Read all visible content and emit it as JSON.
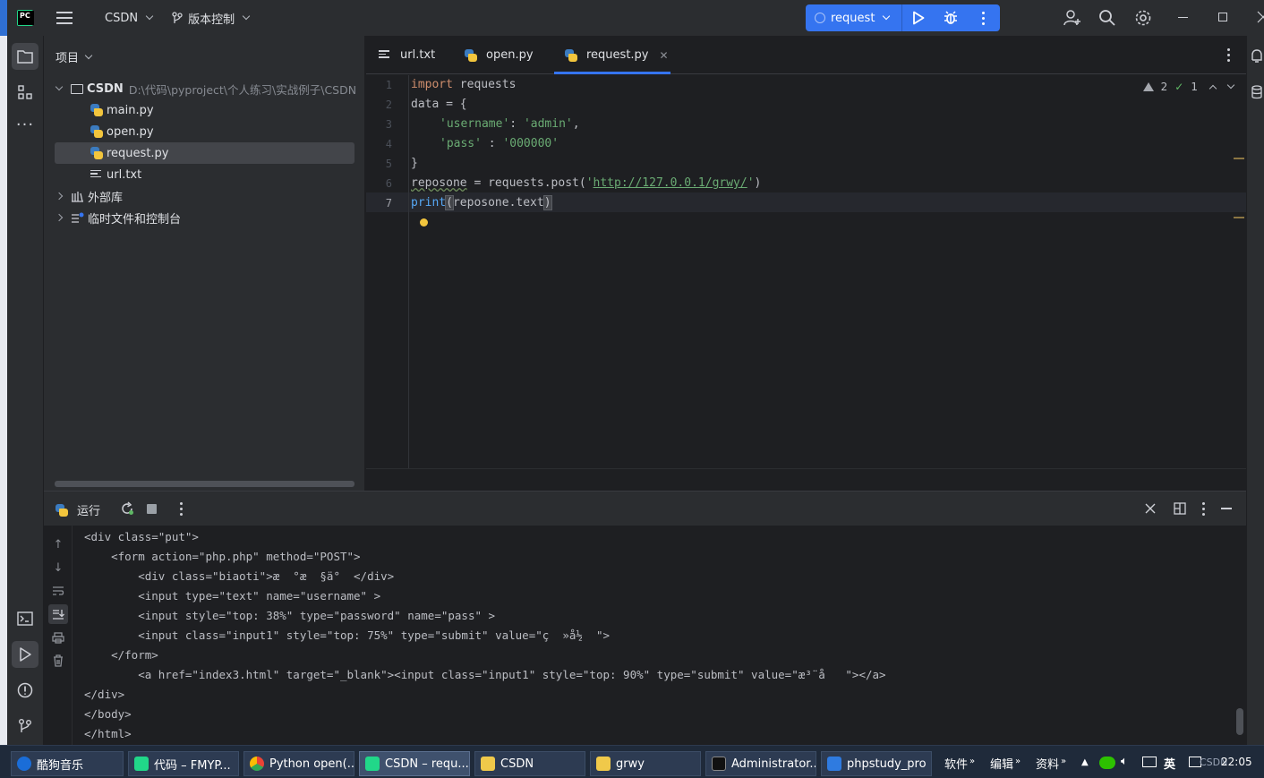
{
  "titlebar": {
    "project_name": "CSDN",
    "vcs_label": "版本控制",
    "run_config": "request"
  },
  "project_panel": {
    "header": "项目",
    "tree": [
      {
        "label": "CSDN",
        "path": "D:\\代码\\pyproject\\个人练习\\实战例子\\CSDN",
        "type": "folder",
        "expanded": true
      },
      {
        "label": "main.py",
        "type": "python"
      },
      {
        "label": "open.py",
        "type": "python"
      },
      {
        "label": "request.py",
        "type": "python",
        "selected": true
      },
      {
        "label": "url.txt",
        "type": "text"
      },
      {
        "label": "外部库",
        "type": "library",
        "expanded": false
      },
      {
        "label": "临时文件和控制台",
        "type": "scratches",
        "expanded": false
      }
    ]
  },
  "editor": {
    "tabs": [
      {
        "label": "url.txt",
        "icon": "text-file-icon"
      },
      {
        "label": "open.py",
        "icon": "python-file-icon"
      },
      {
        "label": "request.py",
        "icon": "python-file-icon",
        "active": true
      }
    ],
    "line_numbers": [
      "1",
      "2",
      "3",
      "4",
      "5",
      "6",
      "7"
    ],
    "current_line": 7,
    "code": {
      "l1_kw": "import",
      "l1_rest": " requests",
      "l2": "data = {",
      "l3_key": "'username'",
      "l3_mid": ": ",
      "l3_val": "'admin'",
      "l3_end": ",",
      "l4_key": "'pass'",
      "l4_mid": " : ",
      "l4_val": "'000000'",
      "l5": "}",
      "l6_var": "reposone",
      "l6_mid": " = requests.post(",
      "l6_q1": "'",
      "l6_url": "http://127.0.0.1/grwy/",
      "l6_q2": "'",
      "l6_end": ")",
      "l7_fn": "print",
      "l7_open": "(",
      "l7_arg": "reposone.text",
      "l7_close": ")"
    },
    "inspections": {
      "warnings": "2",
      "ok": "1"
    }
  },
  "run_panel": {
    "title": "运行",
    "output": [
      "<div class=\"put\">",
      "    <form action=\"php.php\" method=\"POST\">",
      "        <div class=\"biaoti\">æ  °æ  §ä°  </div>",
      "        <input type=\"text\" name=\"username\" >",
      "        <input style=\"top: 38%\" type=\"password\" name=\"pass\" >",
      "        <input class=\"input1\" style=\"top: 75%\" type=\"submit\" value=\"ç  »å½  \">",
      "    </form>",
      "        <a href=\"index3.html\" target=\"_blank\"><input class=\"input1\" style=\"top: 90%\" type=\"submit\" value=\"æ³¨å   \"></a>",
      "</div>",
      "</body>",
      "</html>"
    ]
  },
  "taskbar": {
    "tasks": [
      {
        "label": "酷狗音乐",
        "color": "#1a6dd8"
      },
      {
        "label": "代码 – FMYP...",
        "color": "#21d789"
      },
      {
        "label": "Python open(...",
        "color": "#e3a21a"
      },
      {
        "label": "CSDN – requ...",
        "color": "#21d789",
        "active": true
      },
      {
        "label": "CSDN",
        "color": "#f0c94a"
      },
      {
        "label": "grwy",
        "color": "#f0c94a"
      },
      {
        "label": "Administrator...",
        "color": "#3a3a3a"
      },
      {
        "label": "phpstudy_pro",
        "color": "#2f7be0"
      }
    ],
    "tray": {
      "software": "软件",
      "edit": "编辑",
      "resources": "资料",
      "ime": "英",
      "clock": "22:05",
      "watermark": "CSDN"
    }
  },
  "colors": {
    "accent": "#3574f0",
    "keyword": "#cf8e6d",
    "string": "#6aab73",
    "function": "#56a8f5"
  }
}
